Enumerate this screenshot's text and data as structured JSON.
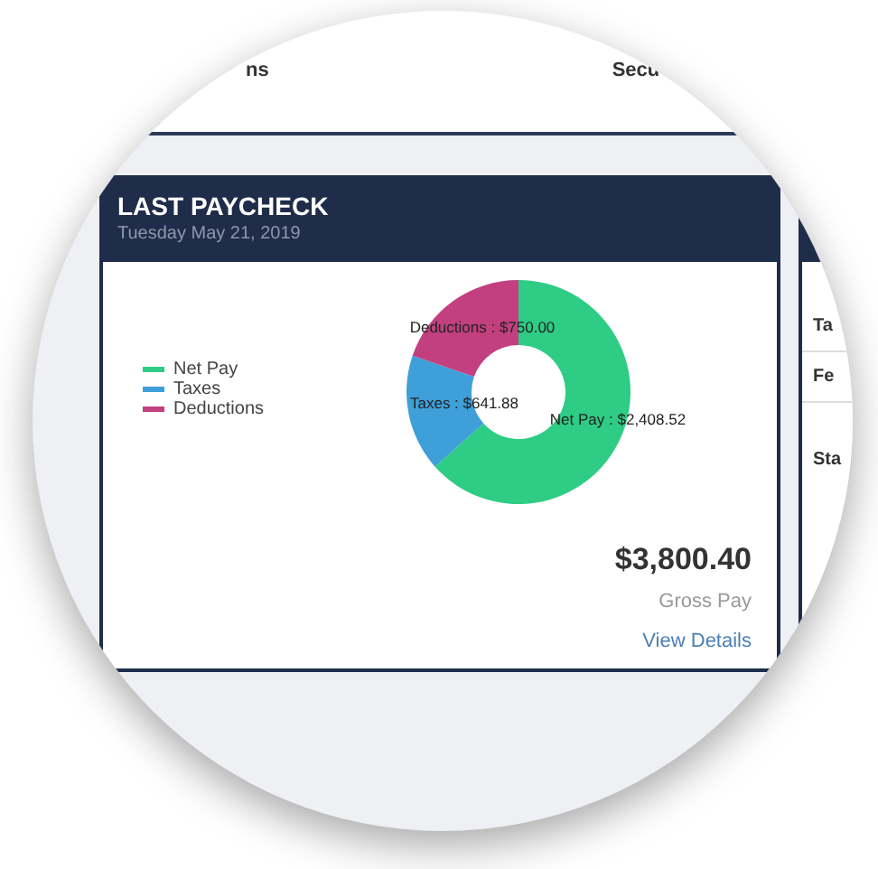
{
  "top_bar": {
    "left_text": "ns",
    "right_text": "Secu"
  },
  "paycheck_card": {
    "title": "LAST PAYCHECK",
    "date": "Tuesday May 21, 2019",
    "legend": [
      {
        "color": "#2ecc85"
      },
      {
        "color": "#3f9fd8"
      },
      {
        "color": "#c2407f"
      }
    ],
    "chart_data": {
      "type": "donut",
      "categories": [
        "Net Pay",
        "Taxes",
        "Deductions"
      ],
      "values": [
        2408.52,
        641.88,
        750.0
      ],
      "value_labels": [
        "Net Pay : $2,408.52",
        "Taxes : $641.88",
        "Deductions : $750.00"
      ]
    },
    "amount": "$3,800.40",
    "amount_label": "Gross Pay",
    "link": "View Details"
  },
  "side_card": {
    "rows": [
      "Ta",
      "Fe",
      "Sta"
    ]
  }
}
